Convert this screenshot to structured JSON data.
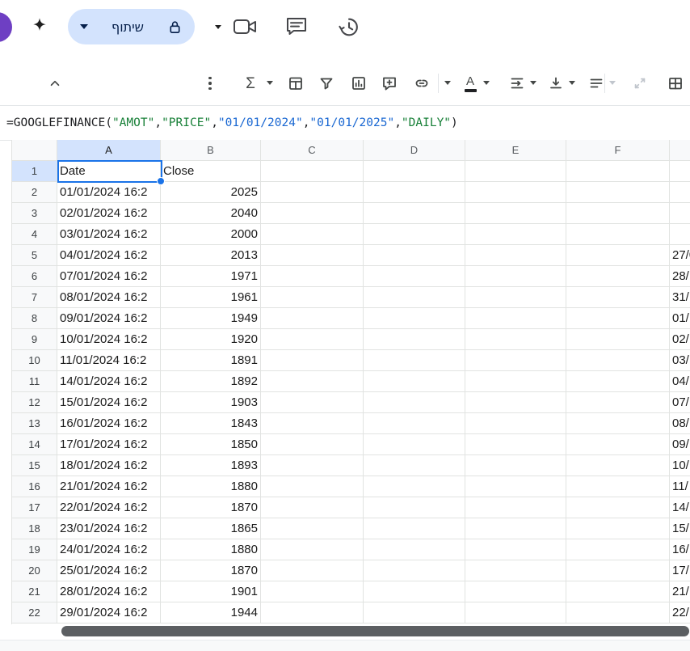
{
  "colors": {
    "accent": "#1a73e8",
    "purple": "#6e3fc3",
    "pill_bg": "#d3e3fd",
    "pill_text": "#041e49",
    "icon": "#444746",
    "icon_dim": "#c1c6cd",
    "text_color_bar": "#202124",
    "header_bg": "#f8f9fa",
    "header_sel": "#d3e3fd",
    "grid_line": "#e1e3e1",
    "tok_string": "#188038",
    "tok_date": "#1967d2",
    "tok_plain": "#202124",
    "scrollbar": "#5c5f62"
  },
  "topbar": {
    "share_label": "שיתוף",
    "icons": [
      "account-avatar",
      "gemini-sparkle",
      "share-dropdown-caret",
      "lock",
      "join-call-caret",
      "video-call",
      "comments",
      "version-history"
    ]
  },
  "toolbar": {
    "glyphs": {
      "sigma": "Σ",
      "letter_a": "A"
    },
    "buttons": [
      "collapse-toolbar",
      "more-options",
      "functions",
      "insert-table",
      "create-filter",
      "insert-chart",
      "insert-comment",
      "insert-link",
      "text-color",
      "text-wrapping",
      "vertical-align",
      "horizontal-align",
      "merge-cells",
      "borders"
    ]
  },
  "formula_bar": {
    "tokens": [
      {
        "type": "plain",
        "text": "=GOOGLEFINANCE("
      },
      {
        "type": "string",
        "text": "\"AMOT\""
      },
      {
        "type": "plain",
        "text": ","
      },
      {
        "type": "string",
        "text": "\"PRICE\""
      },
      {
        "type": "plain",
        "text": ","
      },
      {
        "type": "date",
        "text": "\"01/01/2024\""
      },
      {
        "type": "plain",
        "text": ","
      },
      {
        "type": "date",
        "text": "\"01/01/2025\""
      },
      {
        "type": "plain",
        "text": ","
      },
      {
        "type": "string",
        "text": "\"DAILY\""
      },
      {
        "type": "plain",
        "text": ")"
      }
    ]
  },
  "grid": {
    "column_headers": [
      "A",
      "B",
      "C",
      "D",
      "E",
      "F",
      ""
    ],
    "selected": {
      "cell": "A1",
      "column": "A",
      "row": 1
    },
    "rows": [
      {
        "n": 1,
        "a": "Date",
        "b": "Close",
        "g": ""
      },
      {
        "n": 2,
        "a": "01/01/2024 16:2",
        "b": "2025",
        "g": ""
      },
      {
        "n": 3,
        "a": "02/01/2024 16:2",
        "b": "2040",
        "g": ""
      },
      {
        "n": 4,
        "a": "03/01/2024 16:2",
        "b": "2000",
        "g": ""
      },
      {
        "n": 5,
        "a": "04/01/2024 16:2",
        "b": "2013",
        "g": "27/0"
      },
      {
        "n": 6,
        "a": "07/01/2024 16:2",
        "b": "1971",
        "g": "28/"
      },
      {
        "n": 7,
        "a": "08/01/2024 16:2",
        "b": "1961",
        "g": "31/"
      },
      {
        "n": 8,
        "a": "09/01/2024 16:2",
        "b": "1949",
        "g": "01/"
      },
      {
        "n": 9,
        "a": "10/01/2024 16:2",
        "b": "1920",
        "g": "02/"
      },
      {
        "n": 10,
        "a": "11/01/2024 16:2",
        "b": "1891",
        "g": "03/"
      },
      {
        "n": 11,
        "a": "14/01/2024 16:2",
        "b": "1892",
        "g": "04/"
      },
      {
        "n": 12,
        "a": "15/01/2024 16:2",
        "b": "1903",
        "g": "07/"
      },
      {
        "n": 13,
        "a": "16/01/2024 16:2",
        "b": "1843",
        "g": "08/"
      },
      {
        "n": 14,
        "a": "17/01/2024 16:2",
        "b": "1850",
        "g": "09/"
      },
      {
        "n": 15,
        "a": "18/01/2024 16:2",
        "b": "1893",
        "g": "10/"
      },
      {
        "n": 16,
        "a": "21/01/2024 16:2",
        "b": "1880",
        "g": "11/"
      },
      {
        "n": 17,
        "a": "22/01/2024 16:2",
        "b": "1870",
        "g": "14/"
      },
      {
        "n": 18,
        "a": "23/01/2024 16:2",
        "b": "1865",
        "g": "15/"
      },
      {
        "n": 19,
        "a": "24/01/2024 16:2",
        "b": "1880",
        "g": "16/"
      },
      {
        "n": 20,
        "a": "25/01/2024 16:2",
        "b": "1870",
        "g": "17/"
      },
      {
        "n": 21,
        "a": "28/01/2024 16:2",
        "b": "1901",
        "g": "21/"
      },
      {
        "n": 22,
        "a": "29/01/2024 16:2",
        "b": "1944",
        "g": "22/"
      }
    ]
  }
}
